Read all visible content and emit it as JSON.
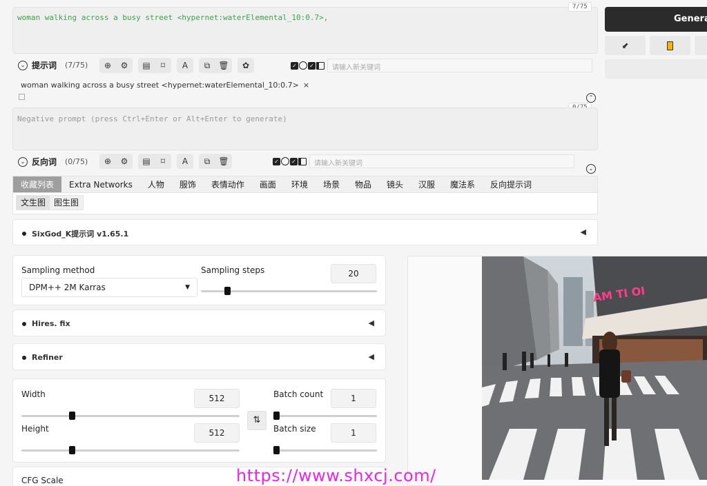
{
  "prompt": {
    "text": "woman walking across a busy street <hypernet:waterElemental_10:0.7>,",
    "counter": "7/75",
    "row_title": "提示词",
    "row_count": "(7/75)",
    "keyword_placeholder": "请输入新关键词",
    "tag_text": "woman walking across a busy street <hypernet:waterElemental_10:0.7>",
    "tag_close": "×"
  },
  "negative": {
    "placeholder": "Negative prompt (press Ctrl+Enter or Alt+Enter to generate)",
    "counter": "0/75",
    "row_title": "反向词",
    "row_count": "(0/75)",
    "keyword_placeholder": "请输入新关键词"
  },
  "tabs": [
    "收藏列表",
    "Extra Networks",
    "人物",
    "服饰",
    "表情动作",
    "画面",
    "环境",
    "场景",
    "物品",
    "镜头",
    "汉服",
    "魔法系",
    "反向提示词"
  ],
  "subtabs": [
    "文生图",
    "图生图"
  ],
  "extension_label": "SixGod_K提示词 v1.65.1",
  "sampling": {
    "method_label": "Sampling method",
    "method_value": "DPM++ 2M Karras",
    "steps_label": "Sampling steps",
    "steps_value": "20",
    "steps_fraction": 0.15
  },
  "hires_label": "Hires. fix",
  "refiner_label": "Refiner",
  "size": {
    "width_label": "Width",
    "width_value": "512",
    "width_fraction": 0.23,
    "height_label": "Height",
    "height_value": "512",
    "height_fraction": 0.23,
    "swap_icon": "⇅",
    "batch_count_label": "Batch count",
    "batch_count_value": "1",
    "batch_size_label": "Batch size",
    "batch_size_value": "1"
  },
  "cfg_label": "CFG Scale",
  "generate_label": "Generate",
  "watermark": "https://www.shxcj.com/",
  "colors": {
    "prompt_text": "#3aa34a",
    "watermark": "#ee22ee",
    "generate_bg": "#2b2b2b"
  }
}
